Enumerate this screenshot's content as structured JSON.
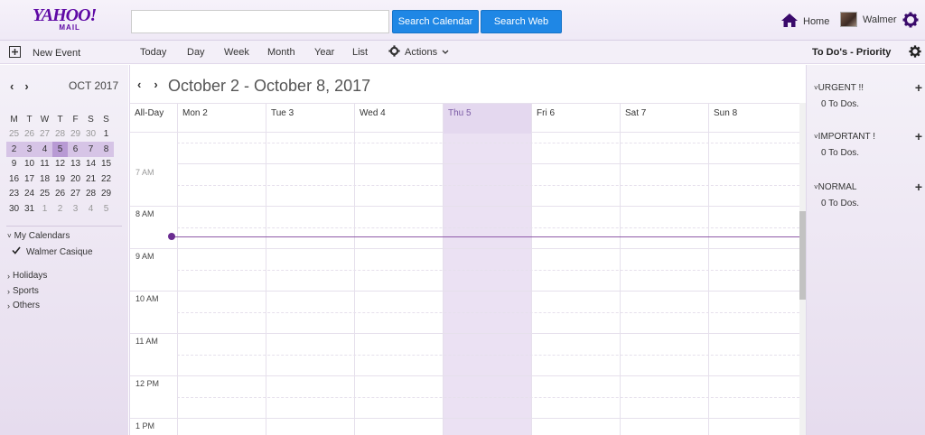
{
  "logo": {
    "main": "YAHOO!",
    "sub": "MAIL"
  },
  "search": {
    "placeholder": "",
    "value": "",
    "search_calendar": "Search Calendar",
    "search_web": "Search Web"
  },
  "user": {
    "home": "Home",
    "name": "Walmer"
  },
  "toolbar": {
    "new_event": "New Event",
    "views": [
      "Today",
      "Day",
      "Week",
      "Month",
      "Year",
      "List"
    ],
    "active_view": "Week",
    "actions": "Actions"
  },
  "mini_calendar": {
    "month": "OCT 2017",
    "weekdays": [
      "M",
      "T",
      "W",
      "T",
      "F",
      "S",
      "S"
    ],
    "weeks": [
      [
        "25",
        "26",
        "27",
        "28",
        "29",
        "30",
        "1"
      ],
      [
        "2",
        "3",
        "4",
        "5",
        "6",
        "7",
        "8"
      ],
      [
        "9",
        "10",
        "11",
        "12",
        "13",
        "14",
        "15"
      ],
      [
        "16",
        "17",
        "18",
        "19",
        "20",
        "21",
        "22"
      ],
      [
        "23",
        "24",
        "25",
        "26",
        "27",
        "28",
        "29"
      ],
      [
        "30",
        "31",
        "1",
        "2",
        "3",
        "4",
        "5"
      ]
    ],
    "today": "5"
  },
  "calendars": {
    "my_calendars": "My Calendars",
    "owner": "Walmer Casique",
    "groups": [
      "Holidays",
      "Sports",
      "Others"
    ]
  },
  "main": {
    "range_title": "October 2 - October 8, 2017",
    "all_day": "All-Day",
    "days": [
      "Mon 2",
      "Tue 3",
      "Wed 4",
      "Thu 5",
      "Fri 6",
      "Sat 7",
      "Sun 8"
    ],
    "today_index": 3,
    "time_labels": [
      "7 AM",
      "8 AM",
      "9 AM",
      "10 AM",
      "11 AM",
      "12 PM",
      "1 PM"
    ]
  },
  "todos": {
    "title": "To Do's - Priority",
    "sections": [
      {
        "label": "URGENT !!",
        "count": "0 To Dos."
      },
      {
        "label": "IMPORTANT !",
        "count": "0 To Dos."
      },
      {
        "label": "NORMAL",
        "count": "0 To Dos."
      }
    ]
  },
  "colors": {
    "brand": "#5f0aa5",
    "button_blue": "#1f87e5",
    "today_column": "#ebe1f3",
    "now_line": "#8e5aa8"
  }
}
